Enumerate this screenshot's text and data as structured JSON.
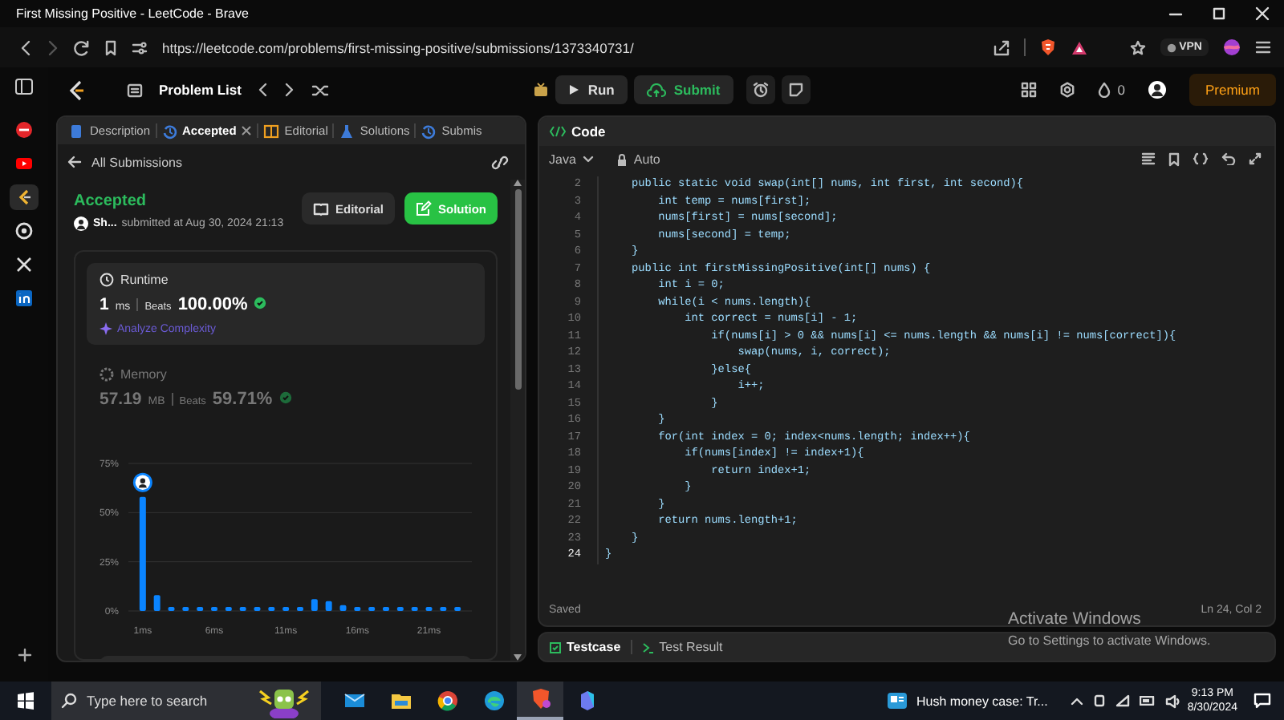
{
  "window": {
    "title": "First Missing Positive - LeetCode - Brave"
  },
  "browser": {
    "url": "https://leetcode.com/problems/first-missing-positive/submissions/1373340731/",
    "vpn_label": "VPN"
  },
  "browser_sidebar": {
    "items": [
      {
        "kind": "panel",
        "selected": false
      },
      {
        "kind": "red",
        "selected": false
      },
      {
        "kind": "video",
        "selected": false
      },
      {
        "kind": "code",
        "selected": true
      },
      {
        "kind": "chat",
        "selected": false
      },
      {
        "kind": "x",
        "selected": false
      },
      {
        "kind": "in",
        "selected": false
      }
    ]
  },
  "topbar": {
    "problem_list": "Problem List",
    "run": "Run",
    "submit": "Submit",
    "streak": "0",
    "premium": "Premium"
  },
  "left_panel": {
    "tabs": [
      {
        "label": "Description",
        "kind": "doc",
        "closable": false,
        "selected": false
      },
      {
        "label": "Accepted",
        "kind": "history",
        "closable": true,
        "selected": true
      },
      {
        "label": "Editorial",
        "kind": "book",
        "closable": false,
        "selected": false
      },
      {
        "label": "Solutions",
        "kind": "flask",
        "closable": false,
        "selected": false
      },
      {
        "label": "Submis",
        "kind": "history",
        "closable": false,
        "selected": false
      }
    ],
    "back_link": "All Submissions",
    "submission": {
      "status": "Accepted",
      "user": "Sh...",
      "submitted": "submitted at Aug 30, 2024 21:13",
      "editorial": "Editorial",
      "solution": "Solution"
    },
    "metrics": [
      {
        "label": "Runtime",
        "kind": "time",
        "value": "1",
        "unit": "ms",
        "beats_label": "Beats",
        "beats": "100.00%",
        "selected": true,
        "link": "Analyze Complexity"
      },
      {
        "label": "Memory",
        "kind": "memory",
        "value": "57.19",
        "unit": "MB",
        "beats_label": "Beats",
        "beats": "59.71%",
        "selected": false
      }
    ],
    "chart_data": {
      "type": "bar",
      "x": [
        1,
        2,
        3,
        4,
        5,
        6,
        7,
        8,
        9,
        10,
        11,
        12,
        13,
        14,
        15,
        16,
        17,
        18,
        19,
        20,
        21,
        22,
        23
      ],
      "values": [
        58,
        8,
        2,
        2,
        2,
        2,
        2,
        2,
        2,
        2,
        2,
        2,
        6,
        5,
        3,
        2,
        2,
        2,
        2,
        2,
        2,
        2,
        2
      ],
      "xlim": [
        0,
        24
      ],
      "ylim": [
        0,
        75
      ],
      "yticks": [
        {
          "value": 0,
          "label": "0%"
        },
        {
          "value": 25,
          "label": "25%"
        },
        {
          "value": 50,
          "label": "50%"
        },
        {
          "value": 75,
          "label": "75%"
        }
      ],
      "xticks": [
        {
          "value": 1,
          "label": "1ms"
        },
        {
          "value": 6,
          "label": "6ms"
        },
        {
          "value": 11,
          "label": "11ms"
        },
        {
          "value": 16,
          "label": "16ms"
        },
        {
          "value": 21,
          "label": "21ms"
        }
      ]
    }
  },
  "editor": {
    "title": "Code",
    "language": "Java",
    "mode": "Auto",
    "lines": [
      {
        "n": "2",
        "code": "    public static void swap(int[] nums, int first, int second){"
      },
      {
        "n": "3",
        "code": "        int temp = nums[first];"
      },
      {
        "n": "4",
        "code": "        nums[first] = nums[second];"
      },
      {
        "n": "5",
        "code": "        nums[second] = temp;"
      },
      {
        "n": "6",
        "code": "    }"
      },
      {
        "n": "7",
        "code": "    public int firstMissingPositive(int[] nums) {"
      },
      {
        "n": "8",
        "code": "        int i = 0;"
      },
      {
        "n": "9",
        "code": "        while(i < nums.length){"
      },
      {
        "n": "10",
        "code": "            int correct = nums[i] - 1;"
      },
      {
        "n": "11",
        "code": "                if(nums[i] > 0 && nums[i] <= nums.length && nums[i] != nums[correct]){"
      },
      {
        "n": "12",
        "code": "                    swap(nums, i, correct);"
      },
      {
        "n": "13",
        "code": "                }else{"
      },
      {
        "n": "14",
        "code": "                    i++;"
      },
      {
        "n": "15",
        "code": "                }"
      },
      {
        "n": "16",
        "code": "        }"
      },
      {
        "n": "17",
        "code": "        for(int index = 0; index<nums.length; index++){"
      },
      {
        "n": "18",
        "code": "            if(nums[index] != index+1){"
      },
      {
        "n": "19",
        "code": "                return index+1;"
      },
      {
        "n": "20",
        "code": "            }"
      },
      {
        "n": "21",
        "code": "        }"
      },
      {
        "n": "22",
        "code": "        return nums.length+1;"
      },
      {
        "n": "23",
        "code": "    }"
      },
      {
        "n": "24",
        "code": "}"
      }
    ],
    "status_left": "Saved",
    "status_right": "Ln 24, Col 2",
    "bottom_tabs": [
      {
        "label": "Testcase",
        "selected": true
      },
      {
        "label": "Test Result",
        "selected": false
      }
    ]
  },
  "taskbar": {
    "search_placeholder": "Type here to search",
    "apps": [
      {
        "kind": "mail",
        "selected": false
      },
      {
        "kind": "folder",
        "selected": false
      },
      {
        "kind": "chrome",
        "selected": false
      },
      {
        "kind": "edge",
        "selected": false
      },
      {
        "kind": "brave",
        "selected": true
      },
      {
        "kind": "copilot",
        "selected": false
      }
    ],
    "news": "Hush money case: Tr...",
    "time": "9:13 PM",
    "date": "8/30/2024"
  },
  "activation_notice": {
    "title": "Activate Windows",
    "text": "Go to Settings to activate Windows."
  }
}
